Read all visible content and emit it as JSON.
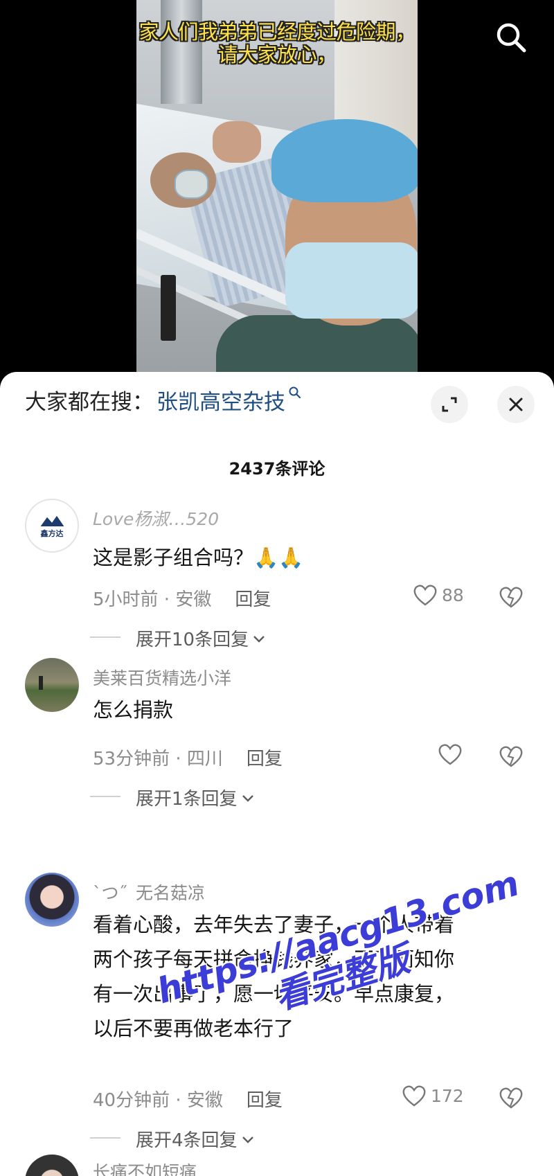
{
  "video": {
    "caption_line1": "家人们我弟弟已经度过危险期，",
    "caption_line2": "请大家放心，"
  },
  "sheet": {
    "hot_search_label": "大家都在搜：",
    "hot_search_keyword": "张凯高空杂技",
    "comment_count": "2437条评论"
  },
  "comments": [
    {
      "username": "Love杨淑…520",
      "avatar_text": "鑫方达",
      "text": "这是影子组合吗？🙏🙏",
      "time": "5小时前 · 安徽",
      "reply_label": "回复",
      "likes": "88",
      "expand": "展开10条回复"
    },
    {
      "username": "美莱百货精选小洋",
      "text": "怎么捐款",
      "time": "53分钟前 · 四川",
      "reply_label": "回复",
      "likes": "",
      "expand": "展开1条回复"
    },
    {
      "username": "无名菇凉",
      "username_prefix": "ˋつ˝",
      "text_lines": [
        "看着心酸，去年失去了妻子，一个人带着",
        "两个孩子每天拼命挣钱养家，不了而知你",
        "有一次出事了，愿一切平安。早点康复，",
        "以后不要再做老本行了"
      ],
      "time": "40分钟前 · 安徽",
      "reply_label": "回复",
      "likes": "172",
      "expand": "展开4条回复"
    },
    {
      "username": "长痛不如短痛"
    }
  ],
  "watermark": {
    "line1": "https://aacg13.com",
    "line2": "看完整版"
  },
  "colors": {
    "caption": "#ffe14a",
    "keyword": "#1f4f82",
    "watermark": "#3c3cd6"
  }
}
